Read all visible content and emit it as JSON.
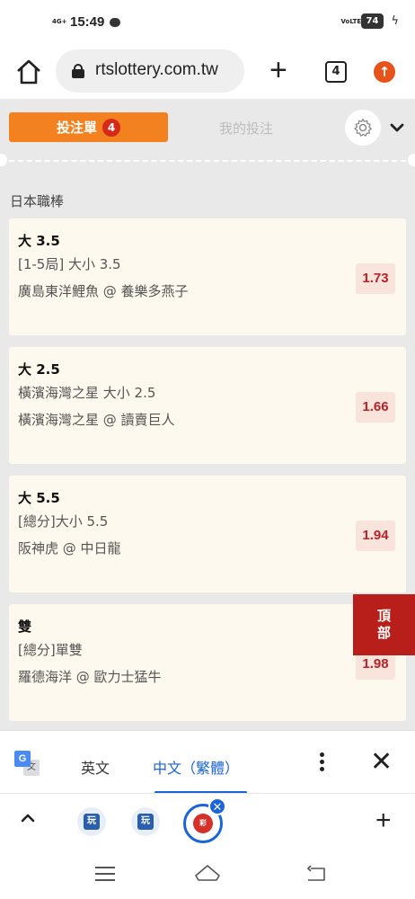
{
  "status_bar": {
    "network": "4G+",
    "time": "15:49",
    "volte": "VoLTE",
    "battery": "74"
  },
  "browser": {
    "url": "rtslottery.com.tw",
    "tab_count": "4",
    "new_tab_label": "+"
  },
  "page": {
    "bet_slip_tab": "投注單",
    "bet_slip_count": "4",
    "my_bets_tab": "我的投注",
    "league": "日本職棒",
    "bets": [
      {
        "pick": "大 3.5",
        "market": "[1-5局] 大小 3.5",
        "match": "廣島東洋鯉魚 @ 養樂多燕子",
        "odds": "1.73"
      },
      {
        "pick": "大 2.5",
        "market": "橫濱海灣之星 大小 2.5",
        "match": "橫濱海灣之星 @ 讀賣巨人",
        "odds": "1.66"
      },
      {
        "pick": "大 5.5",
        "market": "[總分]大小 5.5",
        "match": "阪神虎 @ 中日龍",
        "odds": "1.94"
      },
      {
        "pick": "雙",
        "market": "[總分]單雙",
        "match": "羅德海洋 @ 歐力士猛牛",
        "odds": "1.98"
      }
    ],
    "top_button_line1": "頂",
    "top_button_line2": "部"
  },
  "translate_bar": {
    "lang_en": "英文",
    "lang_zh": "中文（繁體）",
    "close": "✕"
  },
  "tab_strip": {
    "add": "+"
  },
  "colors": {
    "accent_orange": "#f4811f",
    "badge_red": "#d42a1c",
    "odds_text": "#b8222a",
    "card_bg": "#fdf9ee",
    "top_button": "#b81f1a",
    "link_blue": "#1a63d8"
  },
  "icons": {
    "status": [
      "signal-icon",
      "chat-icon",
      "volte-icon",
      "battery-icon",
      "charging-icon"
    ],
    "browser": [
      "home-icon",
      "lock-icon",
      "plus-icon",
      "tab-switcher-icon",
      "update-icon"
    ],
    "page": [
      "gear-icon",
      "chevron-down-icon"
    ],
    "translate": [
      "google-translate-icon",
      "more-vert-icon",
      "close-icon"
    ],
    "nav": [
      "menu-icon",
      "home-outline-icon",
      "back-icon"
    ]
  }
}
